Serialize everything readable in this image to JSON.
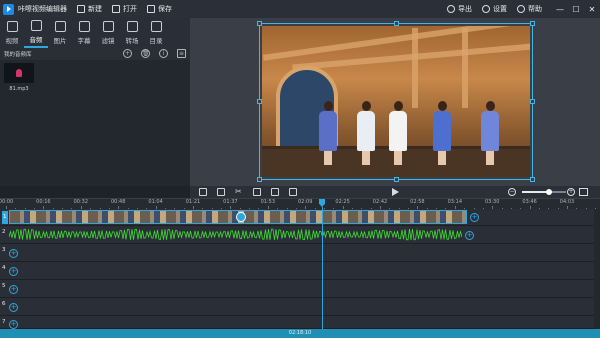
{
  "window": {
    "title": "咔嚓视频编辑器",
    "toolbar": {
      "new_label": "新建",
      "open_label": "打开",
      "save_label": "保存"
    },
    "right_toolbar": {
      "export_label": "导出",
      "settings_label": "设置",
      "help_label": "帮助"
    },
    "controls": {
      "minimize": "—",
      "maximize": "☐",
      "close": "✕"
    }
  },
  "tabs": [
    {
      "label": "视频",
      "icon": "video-icon"
    },
    {
      "label": "音频",
      "icon": "music-icon",
      "active": true
    },
    {
      "label": "图片",
      "icon": "image-icon"
    },
    {
      "label": "字幕",
      "icon": "text-icon"
    },
    {
      "label": "滤镜",
      "icon": "filter-icon"
    },
    {
      "label": "转场",
      "icon": "transition-icon"
    },
    {
      "label": "目录",
      "icon": "list-icon"
    }
  ],
  "library": {
    "title": "我的音频库",
    "tools": {
      "add": "+",
      "delete": "🗑",
      "info": "i",
      "sort": "≡"
    },
    "items": [
      {
        "name": "81.mp3",
        "icon": "music-note-icon"
      }
    ]
  },
  "preview": {
    "play_icon": "play-icon",
    "zoom": {
      "minus": "−",
      "plus": "+",
      "level": 0.62
    }
  },
  "timeline": {
    "ticks": [
      "00:00",
      "00:16",
      "00:32",
      "00:48",
      "01:04",
      "01:21",
      "01:37",
      "01:53",
      "02:09",
      "02:25",
      "02:42",
      "02:58",
      "03:14",
      "03:30",
      "03:46",
      "04:03"
    ],
    "track_numbers": [
      "1",
      "2",
      "3",
      "4",
      "5",
      "6",
      "7"
    ],
    "add_icon": "+",
    "playhead_time": "02:18:10"
  },
  "colors": {
    "accent": "#2ea7e0",
    "waveform": "#3ddc2f",
    "statusbar": "#1f8fb3"
  }
}
